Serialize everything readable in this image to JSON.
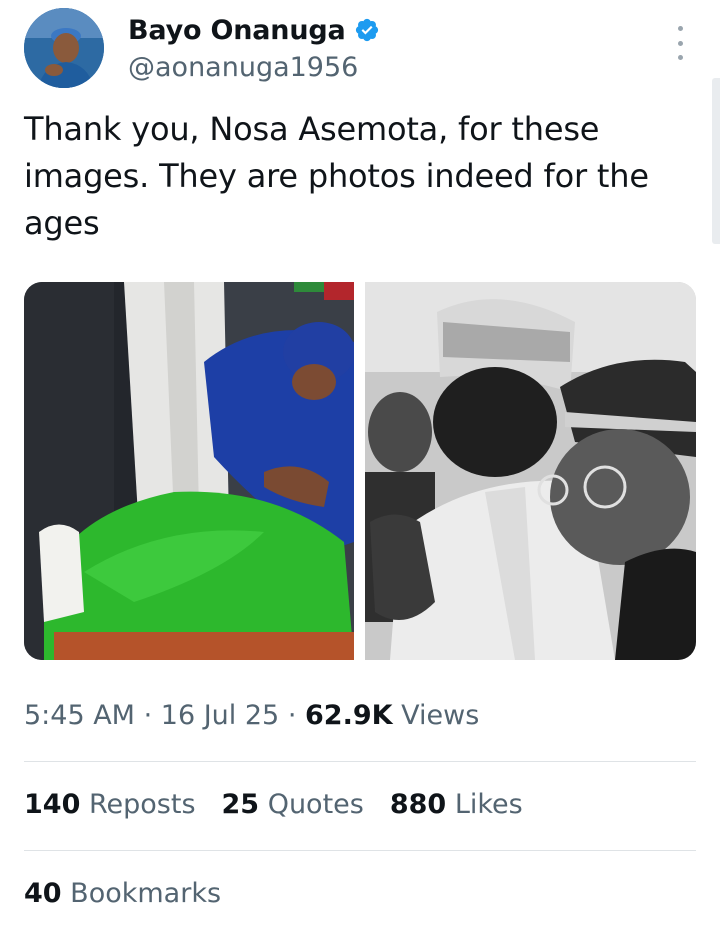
{
  "author": {
    "display_name": "Bayo Onanuga",
    "handle": "@aonanuga1956",
    "verified": true,
    "avatar_icon": "profile-photo"
  },
  "tweet": {
    "text": "Thank you, Nosa Asemota, for these images. They are photos indeed for the ages"
  },
  "media": [
    {
      "kind": "photo",
      "tone": "color",
      "description_icon": "photo-1"
    },
    {
      "kind": "photo",
      "tone": "black-and-white",
      "description_icon": "photo-2"
    }
  ],
  "meta": {
    "time": "5:45 AM",
    "separator": "·",
    "date": "16 Jul 25",
    "views_count": "62.9K",
    "views_label": "Views"
  },
  "stats": {
    "reposts_count": "140",
    "reposts_label": "Reposts",
    "quotes_count": "25",
    "quotes_label": "Quotes",
    "likes_count": "880",
    "likes_label": "Likes",
    "bookmarks_count": "40",
    "bookmarks_label": "Bookmarks"
  },
  "colors": {
    "text_primary": "#0f1419",
    "text_secondary": "#536471",
    "verified_blue": "#1d9bf0",
    "divider": "#dfe3e6"
  }
}
